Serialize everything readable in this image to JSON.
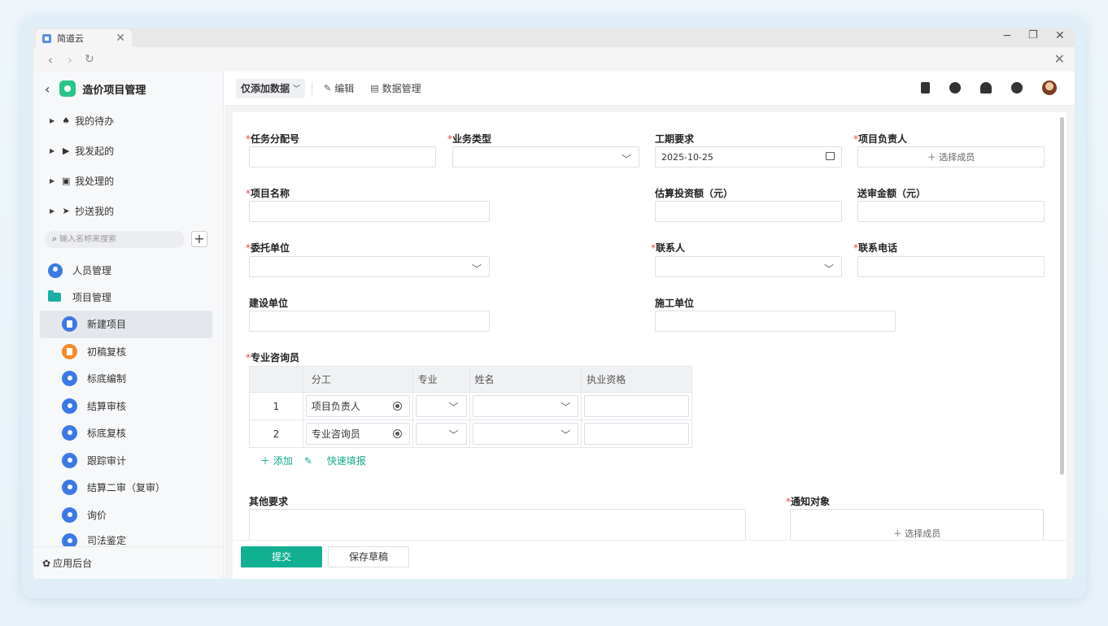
{
  "browser": {
    "tab_title": "简道云",
    "tab_close": "✕",
    "back": "‹",
    "forward": "›",
    "reload": "↻",
    "minimize": "−",
    "restore": "❐",
    "close": "✕",
    "page_close": "✕"
  },
  "sidebar": {
    "back": "‹",
    "app_title": "造价项目管理",
    "quick": [
      {
        "label": "我的待办",
        "icon": "bell-icon",
        "glyph": "♠"
      },
      {
        "label": "我发起的",
        "icon": "play-icon",
        "glyph": "▶"
      },
      {
        "label": "我处理的",
        "icon": "inbox-icon",
        "glyph": "▣"
      },
      {
        "label": "抄送我的",
        "icon": "send-icon",
        "glyph": "➤"
      }
    ],
    "search_placeholder": "输入名称来搜索",
    "add": "+",
    "groups": [
      {
        "label": "人员管理",
        "icon": "people-icon"
      },
      {
        "label": "项目管理",
        "icon": "folder-icon"
      }
    ],
    "items": [
      {
        "label": "新建项目",
        "icon": "form-icon",
        "active": true
      },
      {
        "label": "初稿复核",
        "icon": "report-icon"
      },
      {
        "label": "标底编制",
        "icon": "tag-icon"
      },
      {
        "label": "结算审核",
        "icon": "tag-icon"
      },
      {
        "label": "标底复核",
        "icon": "tag-icon"
      },
      {
        "label": "跟踪审计",
        "icon": "tag-icon"
      },
      {
        "label": "结算二审（复审）",
        "icon": "tag-icon"
      },
      {
        "label": "询价",
        "icon": "tag-icon"
      },
      {
        "label": "司法鉴定",
        "icon": "tag-icon"
      }
    ],
    "footer": "应用后台"
  },
  "toolbar": {
    "mode": "仅添加数据",
    "edit": "编辑",
    "data_manage": "数据管理",
    "right_icons": [
      "book-icon",
      "compass-icon",
      "notification-icon",
      "help-icon",
      "avatar"
    ]
  },
  "form": {
    "required_mark": "*",
    "task_no": {
      "label": "任务分配号",
      "value": ""
    },
    "biz_type": {
      "label": "业务类型",
      "value": ""
    },
    "period": {
      "label": "工期要求",
      "value": "2025-10-25"
    },
    "leader": {
      "label": "项目负责人",
      "button": "＋ 选择成员"
    },
    "project_name": {
      "label": "项目名称",
      "value": ""
    },
    "est_invest": {
      "label": "估算投资额（元）",
      "value": ""
    },
    "review_amount": {
      "label": "送审金额（元）",
      "value": ""
    },
    "client": {
      "label": "委托单位",
      "value": ""
    },
    "contact": {
      "label": "联系人",
      "value": ""
    },
    "phone": {
      "label": "联系电话",
      "value": ""
    },
    "build_unit": {
      "label": "建设单位",
      "value": ""
    },
    "construct_unit": {
      "label": "施工单位",
      "value": ""
    },
    "consultants": {
      "label": "专业咨询员",
      "columns": [
        "",
        "分工",
        "专业",
        "姓名",
        "执业资格"
      ],
      "rows": [
        {
          "num": "1",
          "role": "项目负责人"
        },
        {
          "num": "2",
          "role": "专业咨询员"
        }
      ],
      "add": "＋ 添加",
      "quick_fill": "快速填报"
    },
    "other": {
      "label": "其他要求",
      "value": ""
    },
    "notify": {
      "label": "通知对象",
      "button": "＋ 选择成员"
    },
    "submit": "提交",
    "draft": "保存草稿"
  }
}
